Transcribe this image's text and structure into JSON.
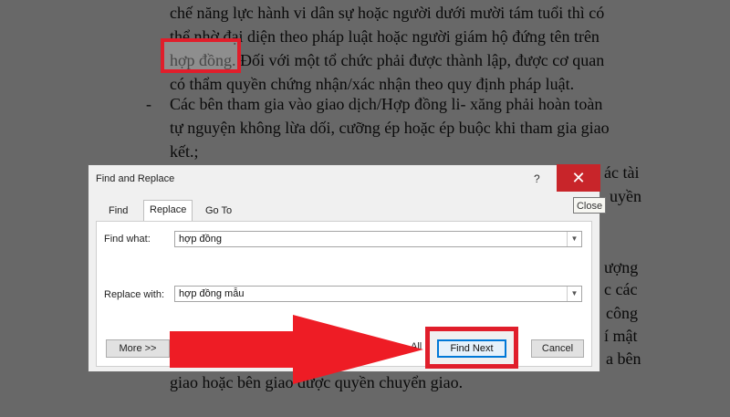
{
  "document": {
    "lines": [
      "chế năng lực hành vi dân sự hoặc người dưới mười tám tuổi thì có",
      "thể nhờ đại diện theo pháp luật hoặc người giám hộ đứng tên trên",
      "hợp đồng. Đối với một tổ chức phải được thành lập, được cơ quan",
      "có thẩm quyền chứng nhận/xác nhận theo quy định pháp luật.",
      "Các bên tham gia vào giao dịch/Hợp đồng li- xăng phải hoàn toàn",
      "tự nguyện không lừa dối, cưỡng ép hoặc ép buộc khi  tham gia giao",
      "kết.;",
      "giao hoặc bên giao được quyền chuyển giao."
    ],
    "bullet": "-",
    "right_fragments": [
      "ác tài",
      "uyền",
      "ượng",
      "c các",
      "công",
      "í mật",
      "a bên"
    ]
  },
  "dialog": {
    "title": "Find and Replace",
    "help": "?",
    "close_symbol": "✕",
    "close_tooltip": "Close",
    "tabs": [
      "Find",
      "Replace",
      "Go To"
    ],
    "find_label": "Find what:",
    "find_value": "hợp đồng",
    "replace_label": "Replace with:",
    "replace_value": "hợp đồng mẫu",
    "more_button": "More >>",
    "all_fragment": "All",
    "find_next_button": "Find Next",
    "cancel_button": "Cancel"
  },
  "colors": {
    "highlight_red": "#e01e2b",
    "close_red": "#c8252a",
    "accent_blue": "#0078d7"
  },
  "icons": {
    "arrow": "red-arrow-icon",
    "dropdown": "chevron-down-icon"
  }
}
